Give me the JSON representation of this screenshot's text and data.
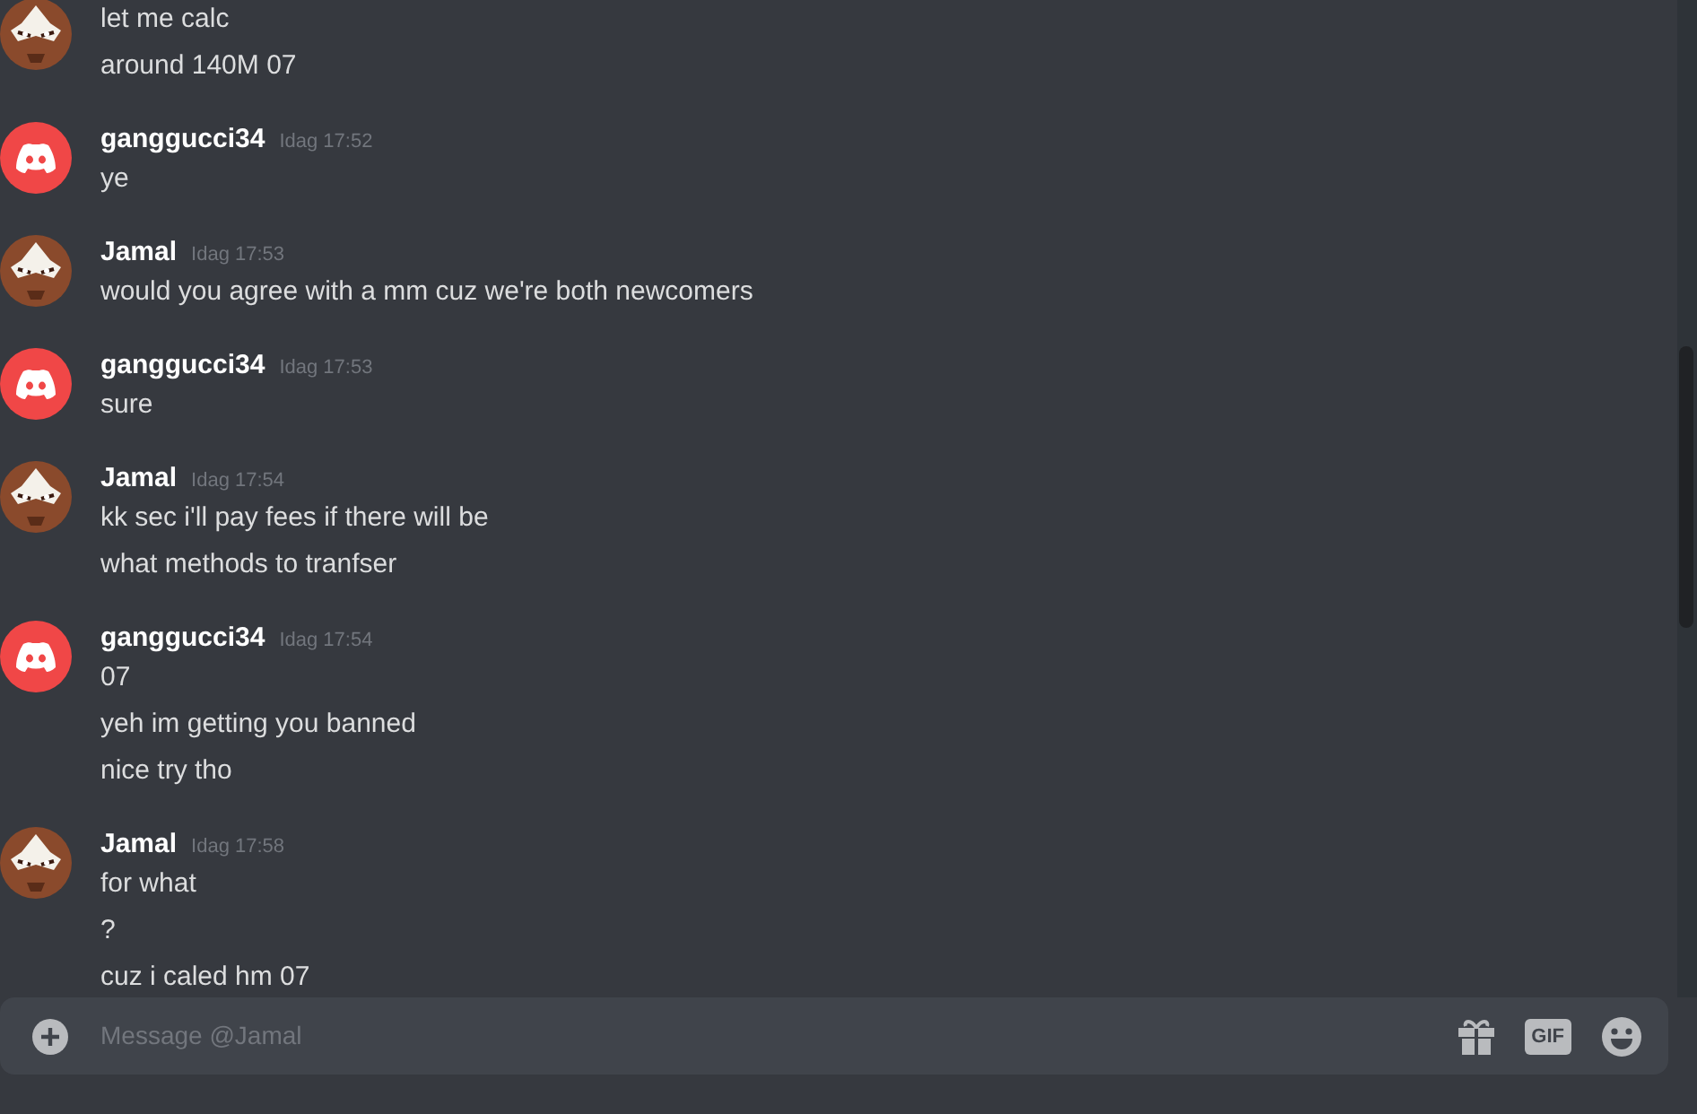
{
  "messages": [
    {
      "kind": "character",
      "lines": [
        "let me calc",
        "around 140M 07"
      ]
    },
    {
      "author": "ganggucci34",
      "time": "Idag 17:52",
      "kind": "logo",
      "lines": [
        "ye"
      ]
    },
    {
      "author": "Jamal",
      "time": "Idag 17:53",
      "kind": "character",
      "lines": [
        "would you agree with a mm cuz we're both newcomers"
      ]
    },
    {
      "author": "ganggucci34",
      "time": "Idag 17:53",
      "kind": "logo",
      "lines": [
        "sure"
      ]
    },
    {
      "author": "Jamal",
      "time": "Idag 17:54",
      "kind": "character",
      "lines": [
        "kk sec i'll pay fees if there will be",
        "what methods to tranfser"
      ]
    },
    {
      "author": "ganggucci34",
      "time": "Idag 17:54",
      "kind": "logo",
      "lines": [
        "07",
        "yeh im getting you banned",
        "nice try tho"
      ]
    },
    {
      "author": "Jamal",
      "time": "Idag 17:58",
      "kind": "character",
      "lines": [
        "for what",
        "?",
        "cuz i caled hm 07"
      ]
    }
  ],
  "composer": {
    "placeholder": "Message @Jamal",
    "gif_label": "GIF"
  }
}
